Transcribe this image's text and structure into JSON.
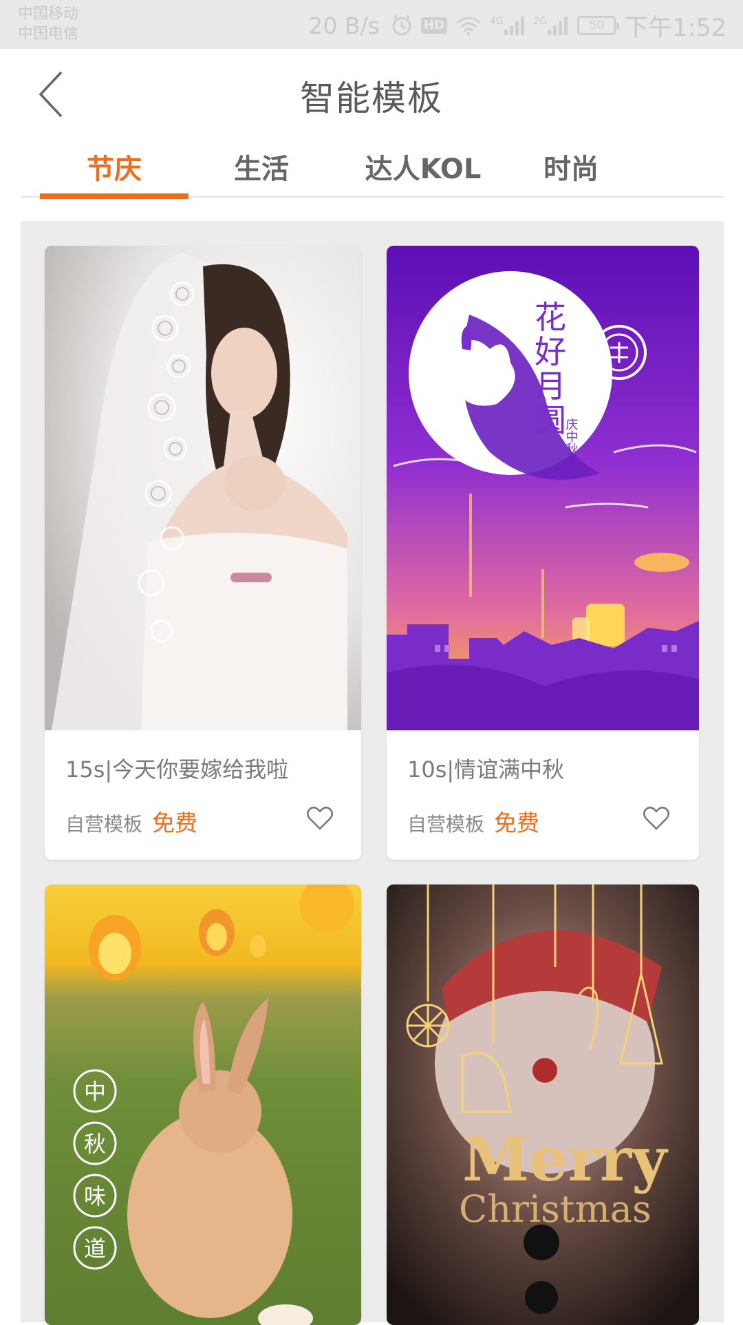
{
  "status_bar": {
    "carrier_1": "中国移动",
    "carrier_2": "中国电信",
    "net_speed": "20 B/s",
    "hd": "HD",
    "signal_1": "4G",
    "signal_2": "2G",
    "battery": "50",
    "time": "下午1:52"
  },
  "header": {
    "title": "智能模板"
  },
  "tabs": [
    {
      "label": "节庆",
      "active": true
    },
    {
      "label": "生活",
      "active": false
    },
    {
      "label": "达人KOL",
      "active": false
    },
    {
      "label": "时尚",
      "active": false
    }
  ],
  "cards": [
    {
      "title": "15s|今天你要嫁给我啦",
      "source": "自营模板",
      "price": "免费"
    },
    {
      "title": "10s|情谊满中秋",
      "source": "自营模板",
      "price": "免费",
      "art_text": [
        "花",
        "好",
        "月",
        "圆",
        "庆中秋"
      ]
    },
    {
      "art_text": [
        "中",
        "秋",
        "味",
        "道"
      ]
    },
    {
      "art_text": [
        "Merry",
        "Christmas"
      ]
    }
  ],
  "colors": {
    "accent": "#ef6c1a",
    "background": "#ececec"
  }
}
